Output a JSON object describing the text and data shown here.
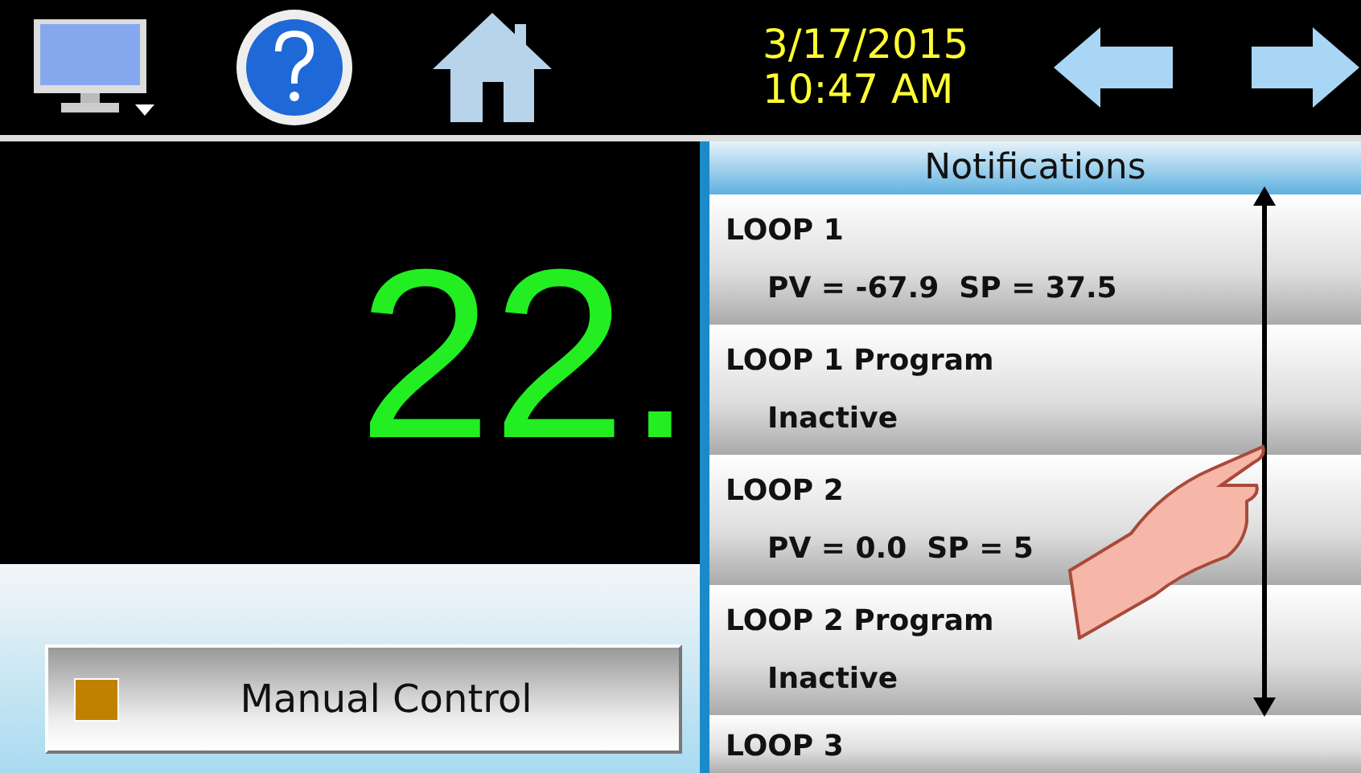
{
  "header": {
    "date": "3/17/2015",
    "time": "10:47 AM"
  },
  "readout": "22.",
  "manual_control": {
    "label": "Manual Control"
  },
  "notifications": {
    "title": "Notifications",
    "items": [
      {
        "title": "LOOP 1",
        "detail": "PV = -67.9  SP = 37.5"
      },
      {
        "title": "LOOP 1 Program",
        "detail": "Inactive"
      },
      {
        "title": "LOOP 2",
        "detail": "PV = 0.0  SP = 5"
      },
      {
        "title": "LOOP 2 Program",
        "detail": "Inactive"
      },
      {
        "title": "LOOP 3"
      }
    ]
  }
}
